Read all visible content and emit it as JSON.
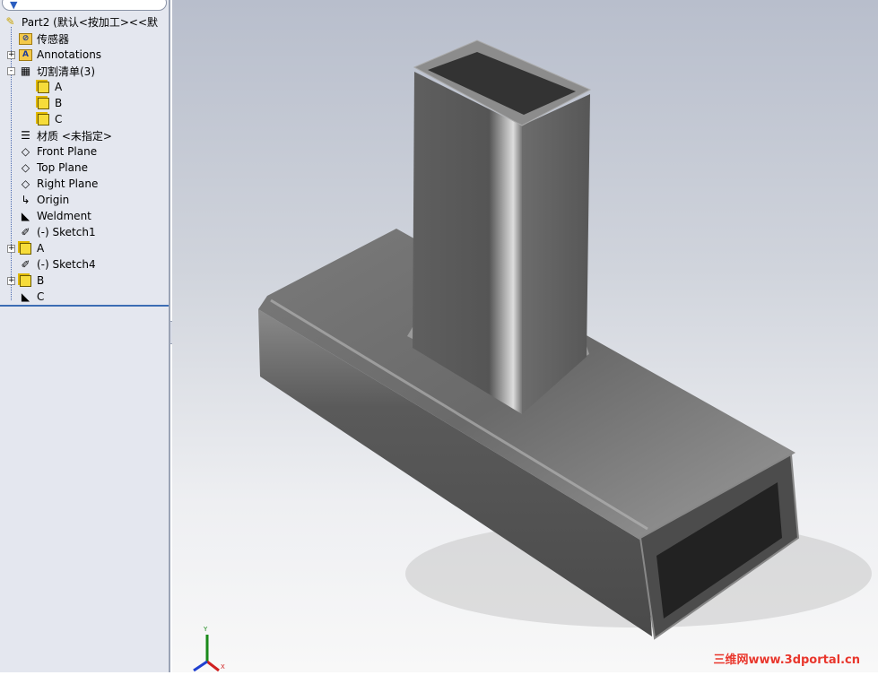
{
  "tree": {
    "filter_icon": "funnel-icon",
    "root": "Part2  (默认<按加工><<默",
    "items": [
      {
        "label": "传感器",
        "icon": "sensor-folder-icon"
      },
      {
        "label": "Annotations",
        "icon": "annotations-folder-icon",
        "expand": "+"
      },
      {
        "label": "切割清单(3)",
        "icon": "cut-list-icon",
        "expand": "-"
      },
      {
        "label": "A",
        "icon": "cut-list-item-icon",
        "child": true
      },
      {
        "label": "B",
        "icon": "cut-list-item-icon",
        "child": true
      },
      {
        "label": "C",
        "icon": "cut-list-item-icon",
        "child": true
      },
      {
        "label": "材质 <未指定>",
        "icon": "material-icon"
      },
      {
        "label": "Front Plane",
        "icon": "plane-icon"
      },
      {
        "label": "Top Plane",
        "icon": "plane-icon"
      },
      {
        "label": "Right Plane",
        "icon": "plane-icon"
      },
      {
        "label": "Origin",
        "icon": "origin-icon"
      },
      {
        "label": "Weldment",
        "icon": "weldment-icon"
      },
      {
        "label": "(-) Sketch1",
        "icon": "sketch-icon"
      },
      {
        "label": "A",
        "icon": "structural-member-icon",
        "expand": "+"
      },
      {
        "label": "(-) Sketch4",
        "icon": "sketch-icon"
      },
      {
        "label": "B",
        "icon": "structural-member-icon",
        "expand": "+"
      },
      {
        "label": "C",
        "icon": "trim-extend-icon"
      }
    ]
  },
  "viewport": {
    "watermark": "三维网www.3dportal.cn",
    "triad": {
      "y": "Y",
      "x": "X"
    }
  }
}
